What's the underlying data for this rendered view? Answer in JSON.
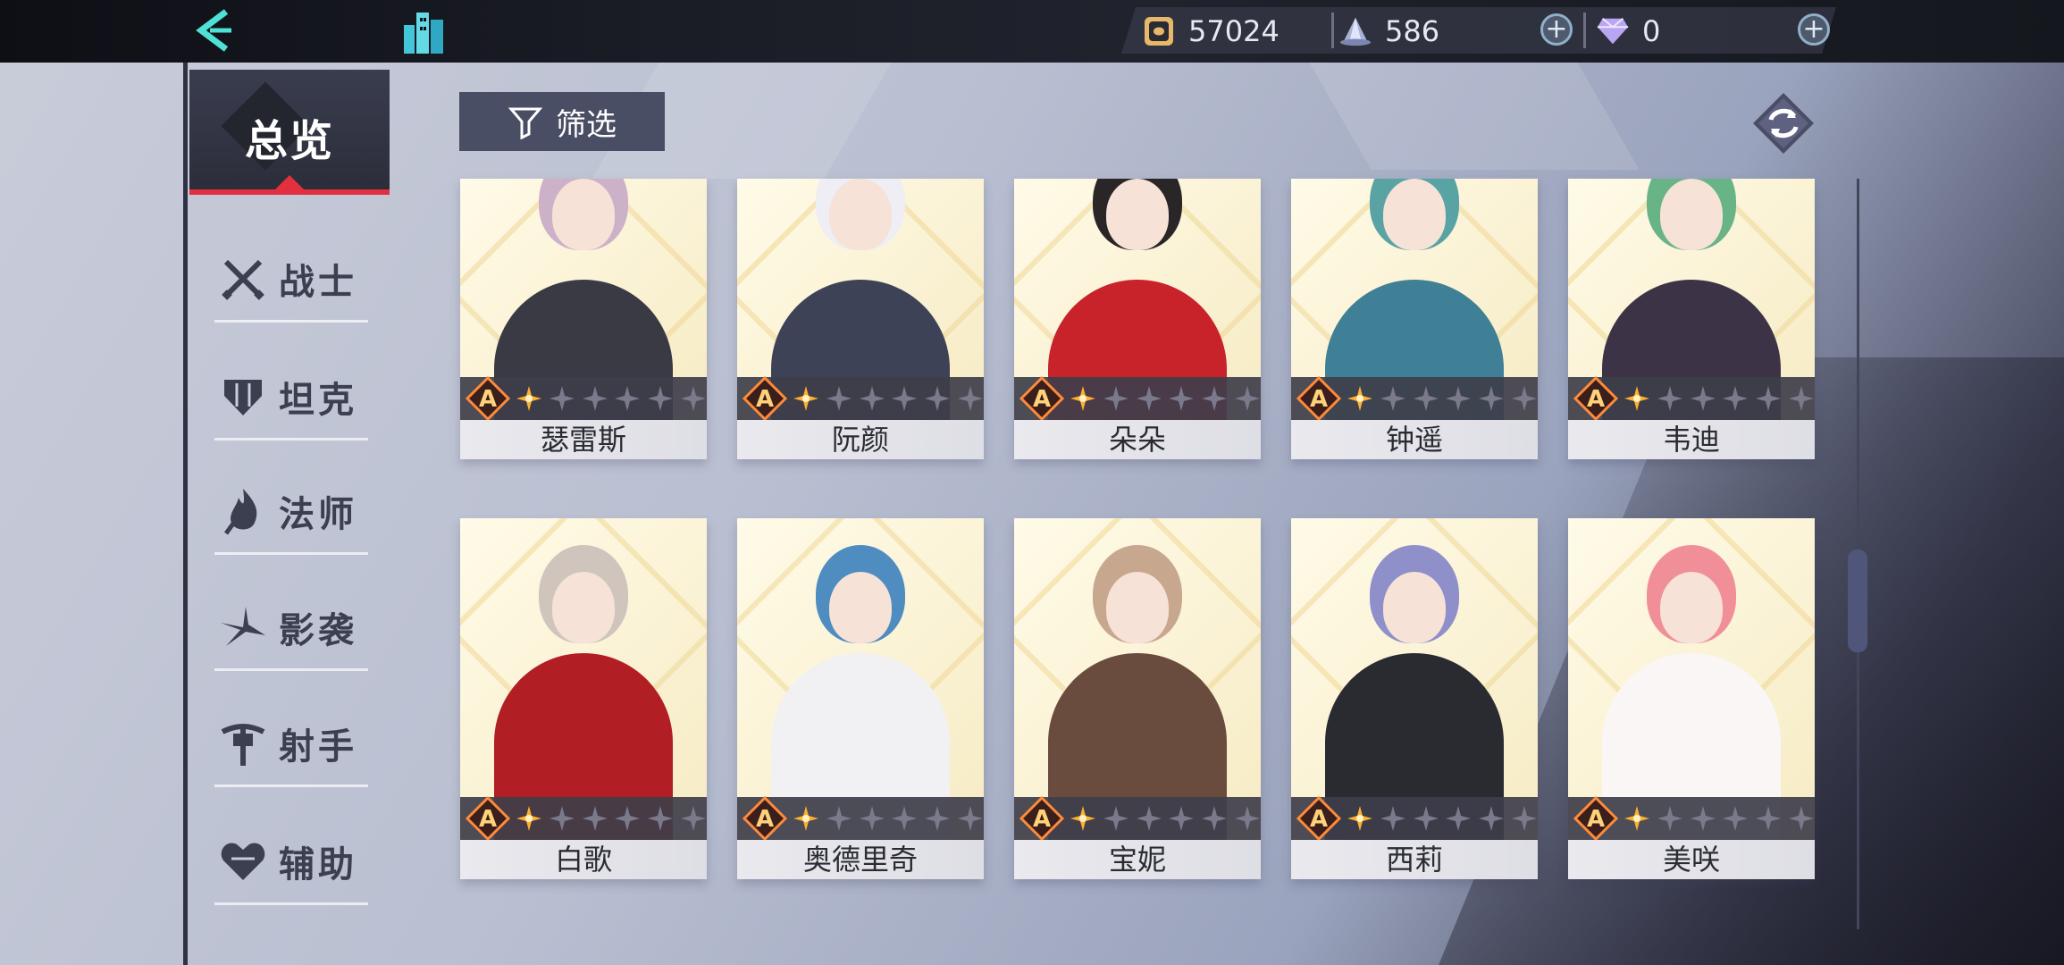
{
  "topbar": {
    "resources": [
      {
        "name": "gold",
        "value": "57024",
        "icon": "coin-icon"
      },
      {
        "name": "crystal",
        "value": "586",
        "icon": "crystal-icon"
      },
      {
        "name": "diamond",
        "value": "0",
        "icon": "diamond-icon"
      }
    ]
  },
  "sidebar": {
    "overview_label": "总览",
    "categories": [
      {
        "label": "战士",
        "icon": "crossed-swords-icon"
      },
      {
        "label": "坦克",
        "icon": "shield-icon"
      },
      {
        "label": "法师",
        "icon": "flame-staff-icon"
      },
      {
        "label": "影袭",
        "icon": "shuriken-icon"
      },
      {
        "label": "射手",
        "icon": "crossbow-icon"
      },
      {
        "label": "辅助",
        "icon": "heart-icon"
      }
    ]
  },
  "filter": {
    "label": "筛选"
  },
  "heroes": [
    {
      "name": "瑟雷斯",
      "rank": "A",
      "stars": 1,
      "hair": "#cdb1c9",
      "outfit": "#3a3a44"
    },
    {
      "name": "阮颜",
      "rank": "A",
      "stars": 1,
      "hair": "#eeeef4",
      "outfit": "#3e4256"
    },
    {
      "name": "朵朵",
      "rank": "A",
      "stars": 1,
      "hair": "#2a2526",
      "outfit": "#c8222a"
    },
    {
      "name": "钟遥",
      "rank": "A",
      "stars": 1,
      "hair": "#5aa3a4",
      "outfit": "#3f8097"
    },
    {
      "name": "韦迪",
      "rank": "A",
      "stars": 1,
      "hair": "#69b486",
      "outfit": "#3c3346"
    },
    {
      "name": "白歌",
      "rank": "A",
      "stars": 1,
      "hair": "#cfc5bd",
      "outfit": "#b11f24"
    },
    {
      "name": "奥德里奇",
      "rank": "A",
      "stars": 1,
      "hair": "#4f8cc0",
      "outfit": "#f1f1f3"
    },
    {
      "name": "宝妮",
      "rank": "A",
      "stars": 1,
      "hair": "#c8a78f",
      "outfit": "#6a4c3e"
    },
    {
      "name": "西莉",
      "rank": "A",
      "stars": 1,
      "hair": "#8f8fc9",
      "outfit": "#2a2b31"
    },
    {
      "name": "美咲",
      "rank": "A",
      "stars": 1,
      "hair": "#f08f97",
      "outfit": "#fbf6f6"
    }
  ]
}
